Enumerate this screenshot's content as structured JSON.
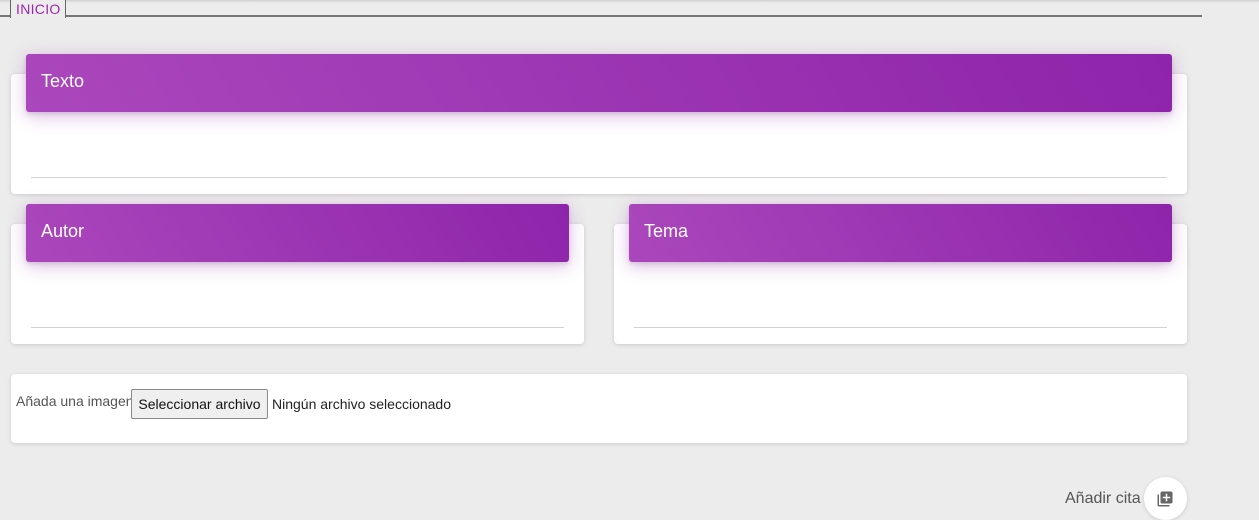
{
  "nav": {
    "tab_label": "INICIO"
  },
  "colors": {
    "accent": "#9c27b0",
    "header_start": "#ab47bc",
    "header_end": "#8e24aa",
    "background": "#ececec"
  },
  "form": {
    "texto": {
      "label": "Texto",
      "value": ""
    },
    "autor": {
      "label": "Autor",
      "value": ""
    },
    "tema": {
      "label": "Tema",
      "value": ""
    },
    "image": {
      "label": "Añada una imagen",
      "button_label": "Seleccionar archivo",
      "status": "Ningún archivo seleccionado"
    }
  },
  "actions": {
    "add_label": "Añadir cita",
    "add_icon": "library-add-icon"
  }
}
